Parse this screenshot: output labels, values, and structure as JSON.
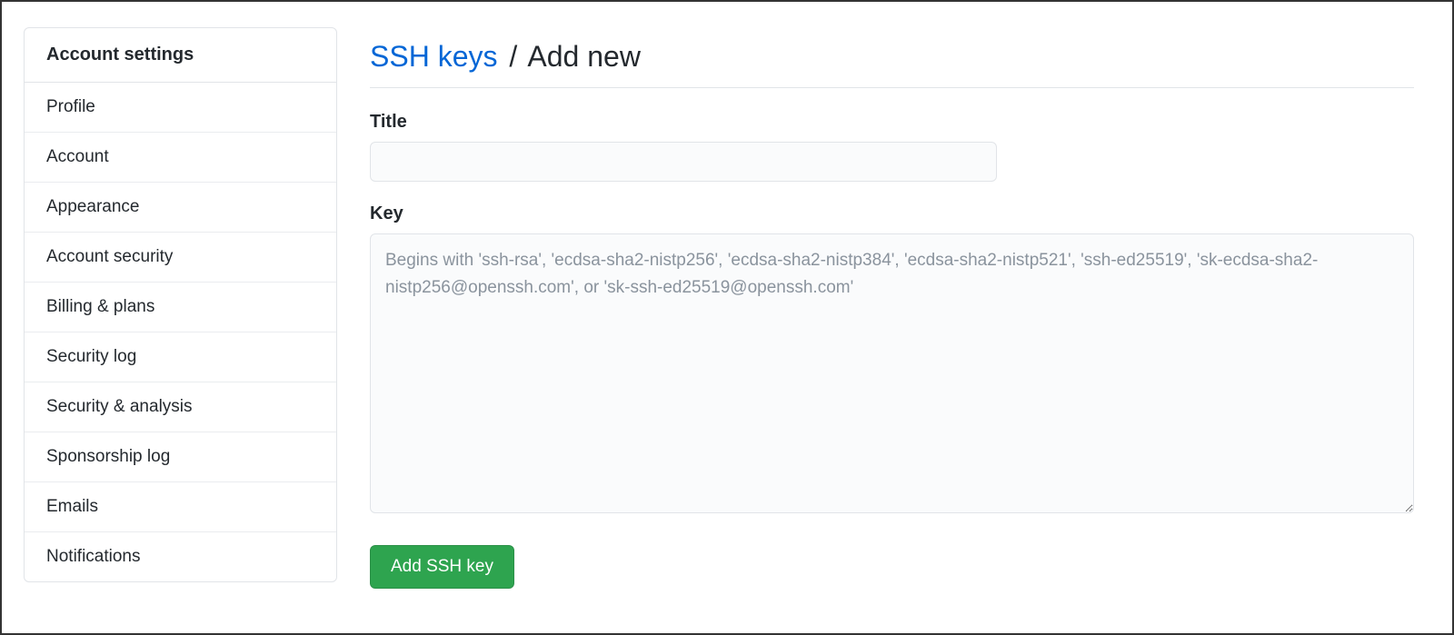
{
  "sidebar": {
    "header": "Account settings",
    "items": [
      {
        "label": "Profile"
      },
      {
        "label": "Account"
      },
      {
        "label": "Appearance"
      },
      {
        "label": "Account security"
      },
      {
        "label": "Billing & plans"
      },
      {
        "label": "Security log"
      },
      {
        "label": "Security & analysis"
      },
      {
        "label": "Sponsorship log"
      },
      {
        "label": "Emails"
      },
      {
        "label": "Notifications"
      }
    ]
  },
  "heading": {
    "link": "SSH keys",
    "separator": "/",
    "current": "Add new"
  },
  "form": {
    "title_label": "Title",
    "title_value": "",
    "key_label": "Key",
    "key_value": "",
    "key_placeholder": "Begins with 'ssh-rsa', 'ecdsa-sha2-nistp256', 'ecdsa-sha2-nistp384', 'ecdsa-sha2-nistp521', 'ssh-ed25519', 'sk-ecdsa-sha2-nistp256@openssh.com', or 'sk-ssh-ed25519@openssh.com'",
    "submit_label": "Add SSH key"
  }
}
